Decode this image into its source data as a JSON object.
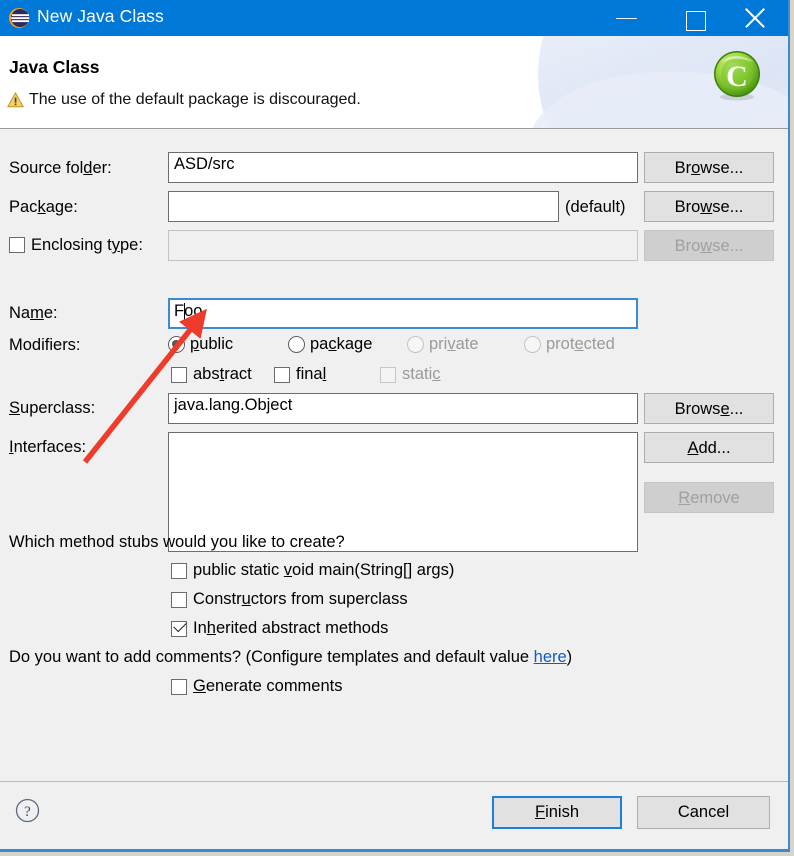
{
  "window": {
    "title": "New Java Class",
    "icon": "eclipse-logo-icon",
    "minimize_label": "Minimize",
    "maximize_label": "Maximize",
    "close_label": "Close",
    "accent_color": "#0078d7"
  },
  "banner": {
    "title": "Java Class",
    "message": "The use of the default package is discouraged.",
    "message_icon": "warning-triangle-icon",
    "page_icon": "java-class-icon"
  },
  "form": {
    "source_folder": {
      "label": "Source fol",
      "label_mnemonic": "d",
      "label_tail": "er:",
      "value": "ASD/src",
      "browse": {
        "pre": "Br",
        "mn": "o",
        "post": "wse..."
      }
    },
    "package": {
      "label": "Pac",
      "label_mnemonic": "k",
      "label_tail": "age:",
      "value": "",
      "suffix": "(default)",
      "browse": {
        "pre": "Bro",
        "mn": "w",
        "post": "se..."
      }
    },
    "enclosing_type": {
      "label": "Enclosing t",
      "label_mnemonic": "y",
      "label_tail": "pe:",
      "value": "",
      "checked": false,
      "enabled": false,
      "browse": {
        "pre": "Bro",
        "mn": "w",
        "post": "se..."
      }
    },
    "name": {
      "label": "Na",
      "label_mnemonic": "m",
      "label_tail": "e:",
      "value": "Foo",
      "focused": true
    },
    "modifiers": {
      "label": "Modifiers:",
      "radios": [
        {
          "pre": "",
          "mn": "p",
          "post": "ublic",
          "selected": true,
          "enabled": true
        },
        {
          "pre": "pa",
          "mn": "c",
          "post": "kage",
          "selected": false,
          "enabled": true
        },
        {
          "pre": "pri",
          "mn": "v",
          "post": "ate",
          "selected": false,
          "enabled": false
        },
        {
          "pre": "prot",
          "mn": "e",
          "post": "cted",
          "selected": false,
          "enabled": false
        }
      ],
      "checkboxes": [
        {
          "pre": "abs",
          "mn": "t",
          "post": "ract",
          "checked": false,
          "enabled": true
        },
        {
          "pre": "fina",
          "mn": "l",
          "post": "",
          "checked": false,
          "enabled": true
        },
        {
          "pre": "stati",
          "mn": "c",
          "post": "",
          "checked": false,
          "enabled": false
        }
      ]
    },
    "superclass": {
      "label": "",
      "label_mnemonic": "S",
      "label_tail": "uperclass:",
      "value": "java.lang.Object",
      "browse": {
        "pre": "Brows",
        "mn": "e",
        "post": "..."
      }
    },
    "interfaces": {
      "label": "",
      "label_mnemonic": "I",
      "label_tail": "nterfaces:",
      "items": [],
      "add": {
        "pre": "",
        "mn": "A",
        "post": "dd..."
      },
      "remove": {
        "pre": "",
        "mn": "R",
        "post": "emove",
        "enabled": false
      }
    },
    "stubs": {
      "question": "Which method stubs would you like to create?",
      "options": [
        {
          "pre": "public static ",
          "mn": "v",
          "post": "oid main(String[] args)",
          "checked": false
        },
        {
          "pre": "Constr",
          "mn": "u",
          "post": "ctors from superclass",
          "checked": false
        },
        {
          "pre": "In",
          "mn": "h",
          "post": "erited abstract methods",
          "checked": true
        }
      ]
    },
    "comments": {
      "question_pre": "Do you want to add comments? (Configure templates and default value ",
      "link_text": "here",
      "question_post": ")",
      "option": {
        "pre": "",
        "mn": "G",
        "post": "enerate comments",
        "checked": false
      }
    }
  },
  "footer": {
    "help_icon": "help-question-icon",
    "finish": {
      "pre": "",
      "mn": "F",
      "post": "inish",
      "is_default": true
    },
    "cancel": {
      "pre": "Cancel",
      "mn": "",
      "post": ""
    }
  },
  "annotation": {
    "type": "arrow",
    "color": "#ef3b2c",
    "points_to": "name-input"
  }
}
